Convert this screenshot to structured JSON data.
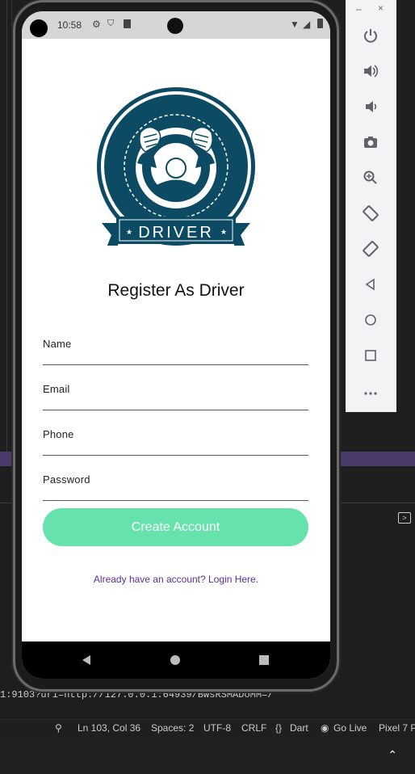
{
  "phone": {
    "status_time": "10:58",
    "title": "Register As Driver",
    "logo_text": "DRIVER",
    "fields": {
      "name_label": "Name",
      "email_label": "Email",
      "phone_label": "Phone",
      "password_label": "Password"
    },
    "create_button": "Create Account",
    "login_link": "Already have an account? Login Here."
  },
  "emulator": {
    "minimize": "–",
    "close": "×"
  },
  "editor": {
    "terminal_line": "1:9103?uri=http://127.0.0.1:64939/BwsRSMADoMM=/",
    "status": {
      "position": "Ln 103, Col 36",
      "spaces": "Spaces: 2",
      "encoding": "UTF-8",
      "eol": "CRLF",
      "language": "Dart",
      "golive": "Go Live",
      "device": "Pixel 7 P"
    }
  },
  "colors": {
    "accent_button": "#66e3ad",
    "link": "#5b2d9a",
    "logo_navy": "#0d4a63"
  }
}
